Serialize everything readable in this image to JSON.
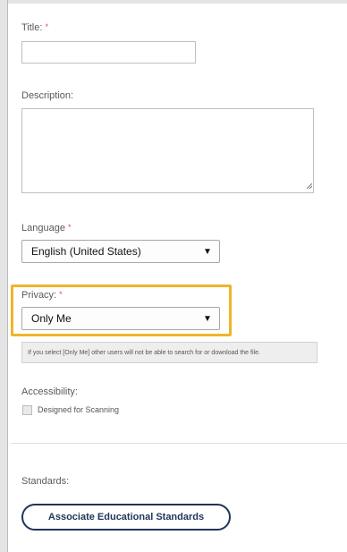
{
  "form": {
    "title_label": "Title:",
    "required_mark": "*",
    "title_value": "",
    "description_label": "Description:",
    "description_value": "",
    "language_label": "Language",
    "language_value": "English (United States)",
    "privacy_label": "Privacy:",
    "privacy_value": "Only Me",
    "privacy_help": "If you select [Only Me] other users will not be able to search for or download the file.",
    "accessibility_label": "Accessibility:",
    "scanning_label": "Designed for Scanning",
    "scanning_checked": false,
    "standards_label": "Standards:",
    "associate_button": "Associate Educational Standards"
  },
  "colors": {
    "highlight": "#f0b429",
    "required": "#d9534f",
    "button_border": "#1f3559"
  },
  "icons": {
    "dropdown": "chevron-down-icon",
    "resize": "resize-handle-icon"
  }
}
